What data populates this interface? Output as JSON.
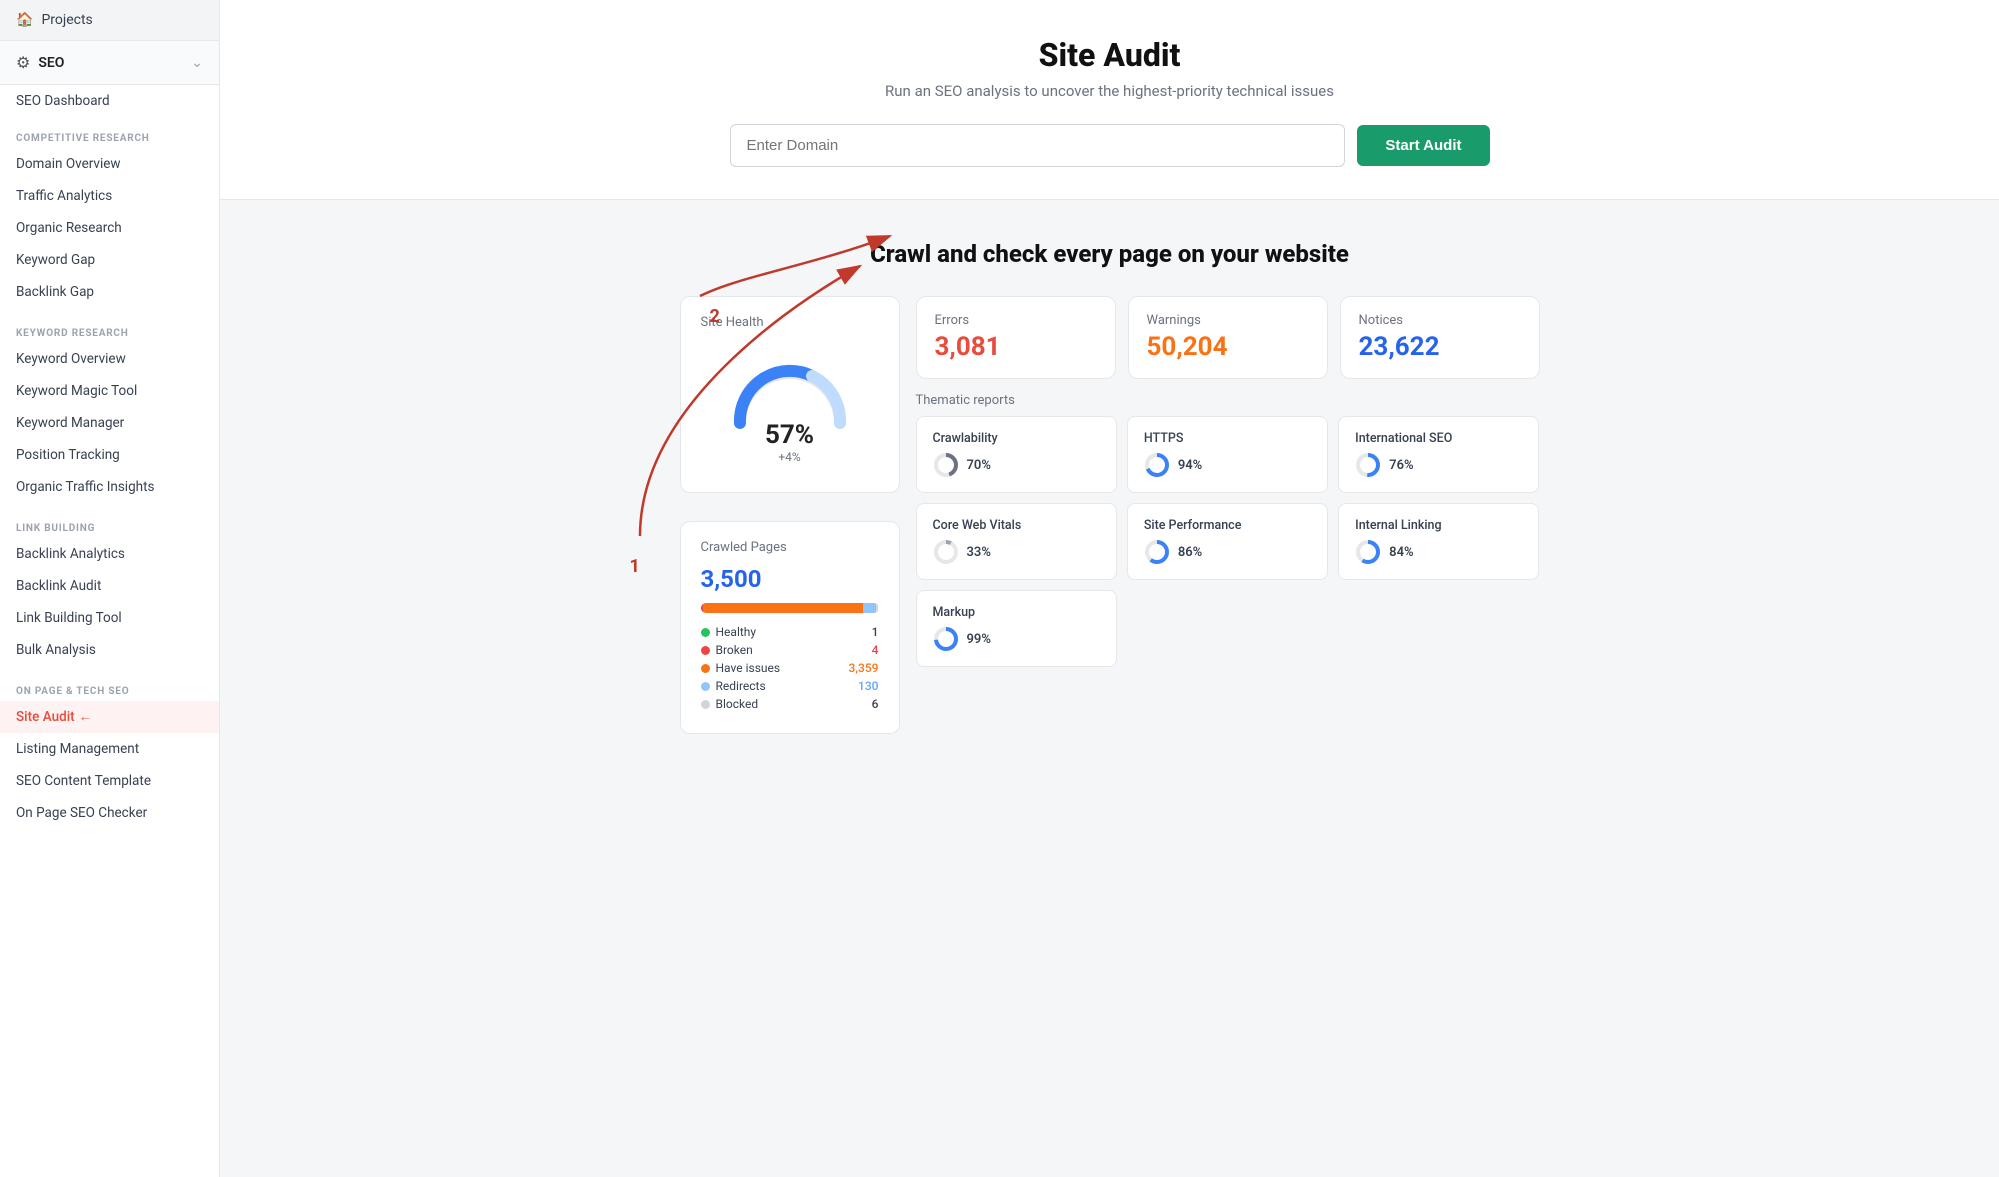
{
  "sidebar": {
    "projects_label": "Projects",
    "seo_label": "SEO",
    "seo_dashboard": "SEO Dashboard",
    "sections": [
      {
        "header": "COMPETITIVE RESEARCH",
        "items": [
          "Domain Overview",
          "Traffic Analytics",
          "Organic Research",
          "Keyword Gap",
          "Backlink Gap"
        ]
      },
      {
        "header": "KEYWORD RESEARCH",
        "items": [
          "Keyword Overview",
          "Keyword Magic Tool",
          "Keyword Manager",
          "Position Tracking",
          "Organic Traffic Insights"
        ]
      },
      {
        "header": "LINK BUILDING",
        "items": [
          "Backlink Analytics",
          "Backlink Audit",
          "Link Building Tool",
          "Bulk Analysis"
        ]
      },
      {
        "header": "ON PAGE & TECH SEO",
        "items": [
          "Site Audit",
          "Listing Management",
          "SEO Content Template",
          "On Page SEO Checker"
        ]
      }
    ],
    "active_item": "Site Audit"
  },
  "hero": {
    "title": "Site Audit",
    "subtitle": "Run an SEO analysis to uncover the highest-priority technical issues",
    "input_placeholder": "Enter Domain",
    "btn_label": "Start Audit"
  },
  "crawl": {
    "title": "Crawl and check every page on your website",
    "annotation1": "1",
    "annotation2": "2"
  },
  "site_health": {
    "label": "Site Health",
    "percent": "57%",
    "delta": "+4%"
  },
  "crawled_pages": {
    "label": "Crawled Pages",
    "count": "3,500",
    "legend": [
      {
        "label": "Healthy",
        "value": "1",
        "color": "#22c55e",
        "pct": 0.5
      },
      {
        "label": "Broken",
        "value": "4",
        "color": "#ef4444",
        "pct": 1
      },
      {
        "label": "Have issues",
        "value": "3,359",
        "color": "#f97316",
        "pct": 90
      },
      {
        "label": "Redirects",
        "value": "130",
        "color": "#93c5fd",
        "pct": 7
      },
      {
        "label": "Blocked",
        "value": "6",
        "color": "#d1d5db",
        "pct": 1.5
      }
    ]
  },
  "stats": [
    {
      "label": "Errors",
      "value": "3,081",
      "color": "red"
    },
    {
      "label": "Warnings",
      "value": "50,204",
      "color": "orange"
    },
    {
      "label": "Notices",
      "value": "23,622",
      "color": "blue"
    }
  ],
  "thematic_reports": {
    "label": "Thematic reports",
    "items": [
      {
        "name": "Crawlability",
        "value": "70%",
        "pct": 70,
        "color": "#d1d5db",
        "fill": "#6b7280"
      },
      {
        "name": "HTTPS",
        "value": "94%",
        "pct": 94,
        "color": "#bfdbfe",
        "fill": "#3b82f6"
      },
      {
        "name": "International SEO",
        "value": "76%",
        "pct": 76,
        "color": "#bfdbfe",
        "fill": "#3b82f6"
      },
      {
        "name": "Core Web Vitals",
        "value": "33%",
        "pct": 33,
        "color": "#e5e7eb",
        "fill": "#9ca3af"
      },
      {
        "name": "Site Performance",
        "value": "86%",
        "pct": 86,
        "color": "#bfdbfe",
        "fill": "#3b82f6"
      },
      {
        "name": "Internal Linking",
        "value": "84%",
        "pct": 84,
        "color": "#bfdbfe",
        "fill": "#3b82f6"
      },
      {
        "name": "Markup",
        "value": "99%",
        "pct": 99,
        "color": "#bfdbfe",
        "fill": "#3b82f6"
      }
    ]
  }
}
